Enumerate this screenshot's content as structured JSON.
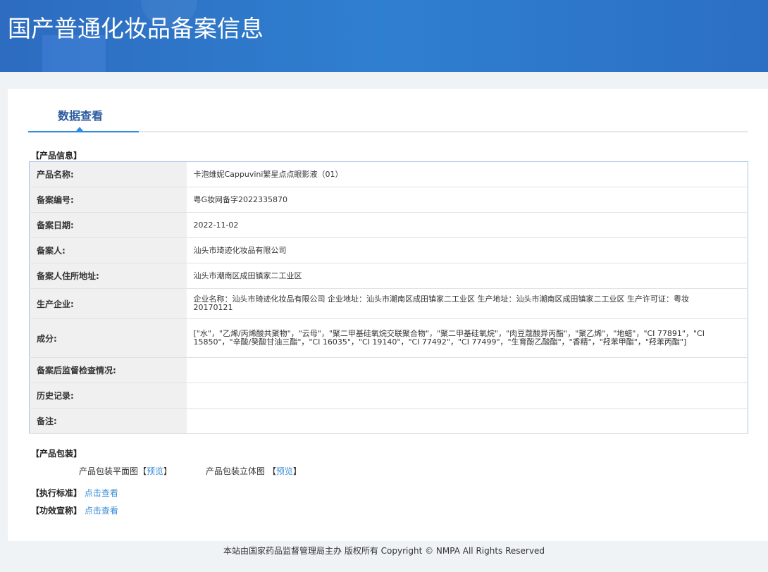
{
  "header": {
    "title": "国产普通化妆品备案信息"
  },
  "tab": {
    "label": "数据查看"
  },
  "product_info": {
    "section_title": "【产品信息】",
    "rows": [
      {
        "label": "产品名称:",
        "value": "卡泡维妮Cappuvini繁星点点眼影液（01）"
      },
      {
        "label": "备案编号:",
        "value": "粤G妆网备字2022335870"
      },
      {
        "label": "备案日期:",
        "value": "2022-11-02"
      },
      {
        "label": "备案人:",
        "value": "汕头市琦迹化妆品有限公司"
      },
      {
        "label": "备案人住所地址:",
        "value": "汕头市潮南区成田镇家二工业区"
      },
      {
        "label": "生产企业:",
        "value": "企业名称：汕头市琦迹化妆品有限公司 企业地址：汕头市潮南区成田镇家二工业区 生产地址：汕头市潮南区成田镇家二工业区 生产许可证：粤妆20170121"
      },
      {
        "label": "成分:",
        "value": "[\"水\"，\"乙烯/丙烯酸共聚物\"，\"云母\"，\"聚二甲基硅氧烷交联聚合物\"，\"聚二甲基硅氧烷\"，\"肉豆蔻酸异丙酯\"，\"聚乙烯\"，\"地蜡\"，\"CI 77891\"，\"CI 15850\"，\"辛酸/癸酸甘油三酯\"，\"CI 16035\"，\"CI 19140\"，\"CI 77492\"，\"CI 77499\"，\"生育酚乙酸酯\"，\"香精\"，\"羟苯甲酯\"，\"羟苯丙酯\"]"
      },
      {
        "label": "备案后监督检查情况:",
        "value": ""
      },
      {
        "label": "历史记录:",
        "value": ""
      },
      {
        "label": "备注:",
        "value": ""
      }
    ]
  },
  "packaging": {
    "section_title": "【产品包装】",
    "flat_label": "产品包装平面图",
    "solid_label": "产品包装立体图",
    "bracket_open": "【",
    "bracket_close": "】",
    "preview": "预览"
  },
  "standard": {
    "label": "【执行标准】",
    "link": "点击查看"
  },
  "efficacy": {
    "label": "【功效宣称】",
    "link": "点击查看"
  },
  "footer": {
    "text": "本站由国家药品监督管理局主办 版权所有 Copyright © NMPA All Rights Reserved"
  }
}
